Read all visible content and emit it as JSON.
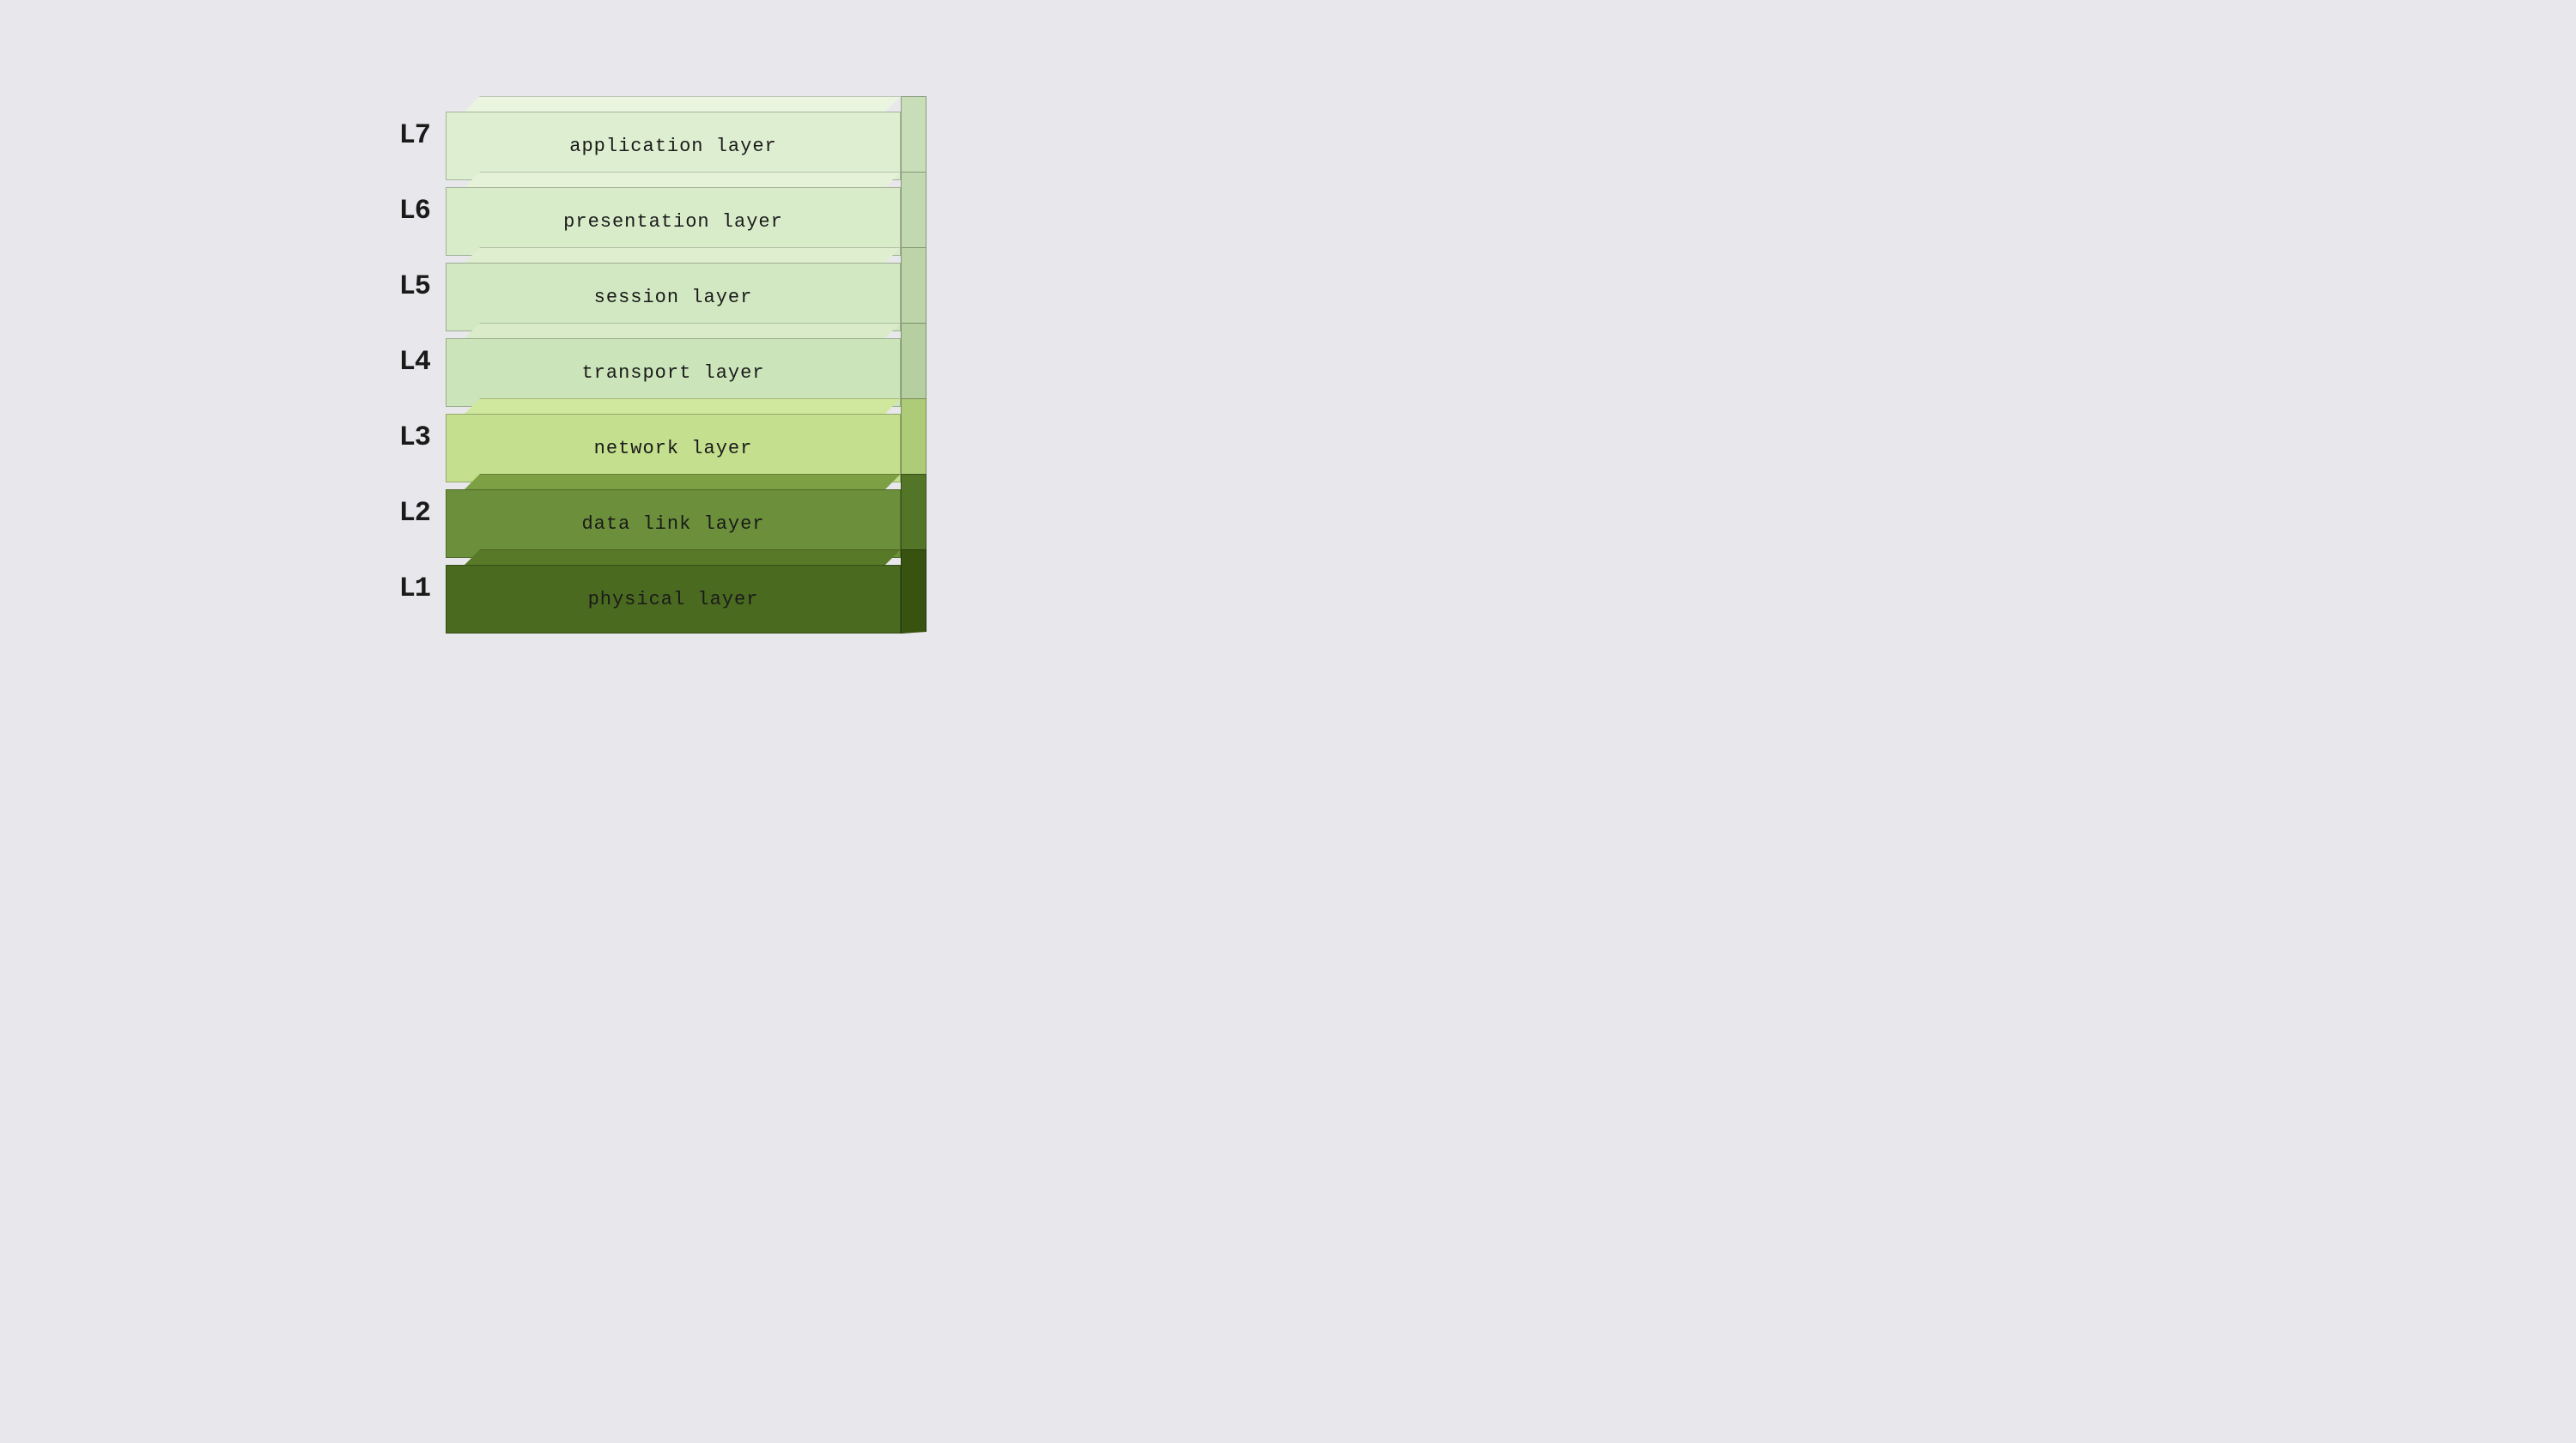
{
  "layers": [
    {
      "id": "l7",
      "label": "L7",
      "name": "application layer"
    },
    {
      "id": "l6",
      "label": "L6",
      "name": "presentation layer"
    },
    {
      "id": "l5",
      "label": "L5",
      "name": "session layer"
    },
    {
      "id": "l4",
      "label": "L4",
      "name": "transport layer"
    },
    {
      "id": "l3",
      "label": "L3",
      "name": "network layer"
    },
    {
      "id": "l2",
      "label": "L2",
      "name": "data link layer"
    },
    {
      "id": "l1",
      "label": "L1",
      "name": "physical layer"
    }
  ]
}
